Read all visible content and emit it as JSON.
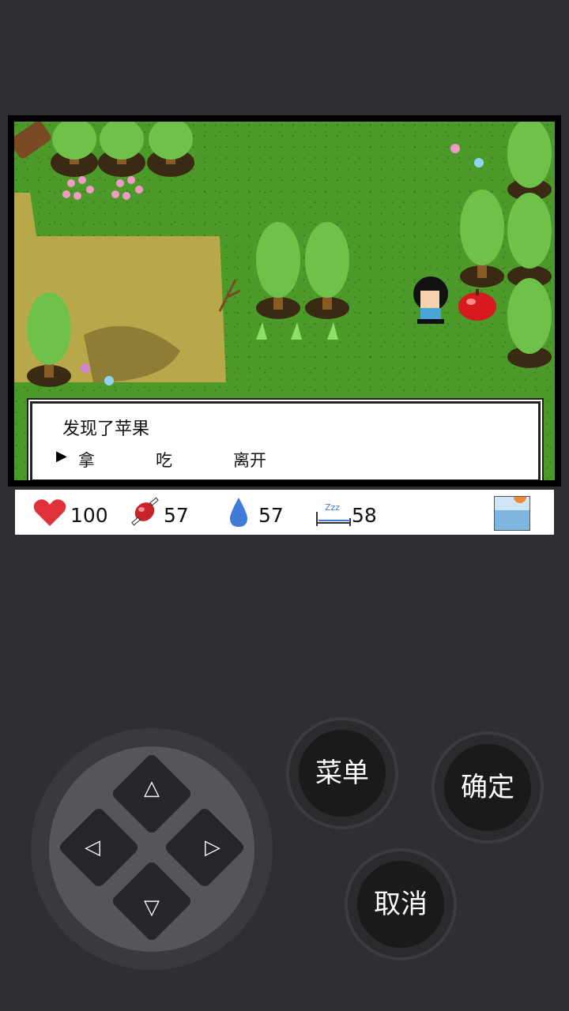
{
  "dialog": {
    "message": "发现了苹果",
    "choices": [
      "拿",
      "吃",
      "离开"
    ],
    "selected_index": 0,
    "cursor_glyph": "▶"
  },
  "stats": {
    "health": "100",
    "food": "57",
    "water": "57",
    "sleep": "58",
    "sleep_label": "Zzz"
  },
  "buttons": {
    "menu": "菜单",
    "confirm": "确定",
    "cancel": "取消"
  },
  "dpad": {
    "up": "△",
    "down": "▽",
    "left": "◁",
    "right": "▷"
  },
  "icons": {
    "health": "heart-icon",
    "food": "meat-icon",
    "water": "water-drop-icon",
    "sleep": "sleep-bed-icon",
    "weather": "weather-sun-sea-icon"
  },
  "colors": {
    "grass": "#4c9a2a",
    "dirt": "#b9a84a",
    "heart": "#e0313a",
    "water": "#3f7bd9"
  }
}
